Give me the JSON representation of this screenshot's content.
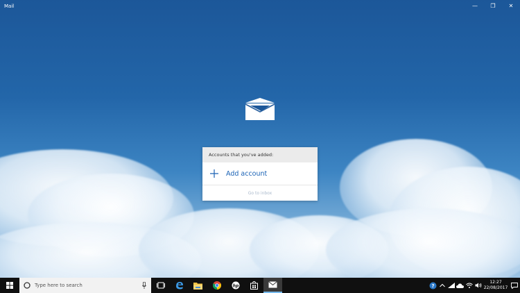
{
  "window": {
    "title": "Mail",
    "controls": {
      "minimize": "—",
      "restore": "❐",
      "close": "✕"
    }
  },
  "accounts_panel": {
    "header": "Accounts that you've added:",
    "add_account_label": "Add account",
    "go_to_inbox_label": "Go to inbox"
  },
  "taskbar": {
    "search_placeholder": "Type here to search",
    "pinned_icons": [
      "task-view-icon",
      "edge-icon",
      "file-explorer-icon",
      "chrome-icon",
      "hp-icon",
      "store-icon",
      "mail-icon"
    ],
    "active_app": "mail-icon",
    "clock": {
      "time": "12:27",
      "date": "22/08/2017"
    }
  },
  "colors": {
    "accent": "#1a62b5",
    "taskbar": "#101010",
    "panel_header": "#ebebeb"
  }
}
